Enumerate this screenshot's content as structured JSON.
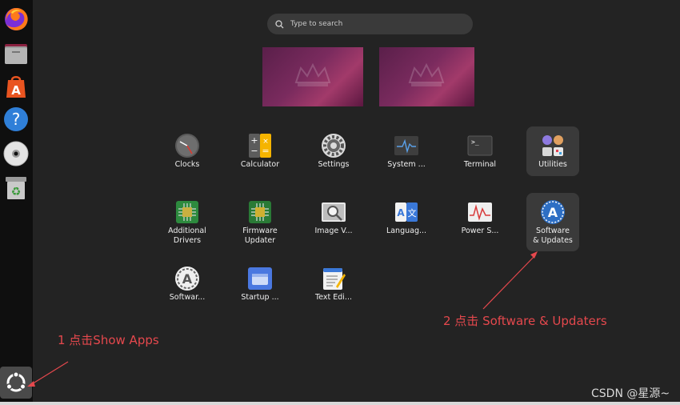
{
  "search": {
    "placeholder": "Type to search"
  },
  "dock": {
    "apps": [
      {
        "name": "firefox-icon"
      },
      {
        "name": "files-icon"
      },
      {
        "name": "app-center-icon"
      },
      {
        "name": "help-icon"
      },
      {
        "name": "disc-icon"
      },
      {
        "name": "trash-icon"
      }
    ],
    "show_apps": {
      "name": "show-apps-icon"
    }
  },
  "apps": [
    {
      "label": "Clocks",
      "icon": "clock-icon"
    },
    {
      "label": "Calculator",
      "icon": "calculator-icon"
    },
    {
      "label": "Settings",
      "icon": "settings-icon"
    },
    {
      "label": "System ...",
      "icon": "system-monitor-icon"
    },
    {
      "label": "Terminal",
      "icon": "terminal-icon"
    },
    {
      "label": "Utilities",
      "icon": "utilities-folder-icon"
    },
    {
      "label1": "Additional",
      "label2": "Drivers",
      "icon": "chip-icon"
    },
    {
      "label1": "Firmware",
      "label2": "Updater",
      "icon": "firmware-chip-icon"
    },
    {
      "label": "Image V...",
      "icon": "image-viewer-icon"
    },
    {
      "label": "Languag...",
      "icon": "language-icon"
    },
    {
      "label": "Power S...",
      "icon": "power-statistics-icon"
    },
    {
      "label1": "Software",
      "label2": "& Updates",
      "icon": "software-updates-icon"
    },
    {
      "label": "Softwar...",
      "icon": "software-icon"
    },
    {
      "label": "Startup ...",
      "icon": "startup-icon"
    },
    {
      "label": "Text Edi...",
      "icon": "text-editor-icon"
    }
  ],
  "annotations": {
    "step1": "1 点击Show Apps",
    "step2": "2 点击 Software & Updaters"
  },
  "watermark": "CSDN @星源~",
  "colors": {
    "annotation": "#e5484d",
    "background": "#232323",
    "dock": "#0f0f0f"
  }
}
